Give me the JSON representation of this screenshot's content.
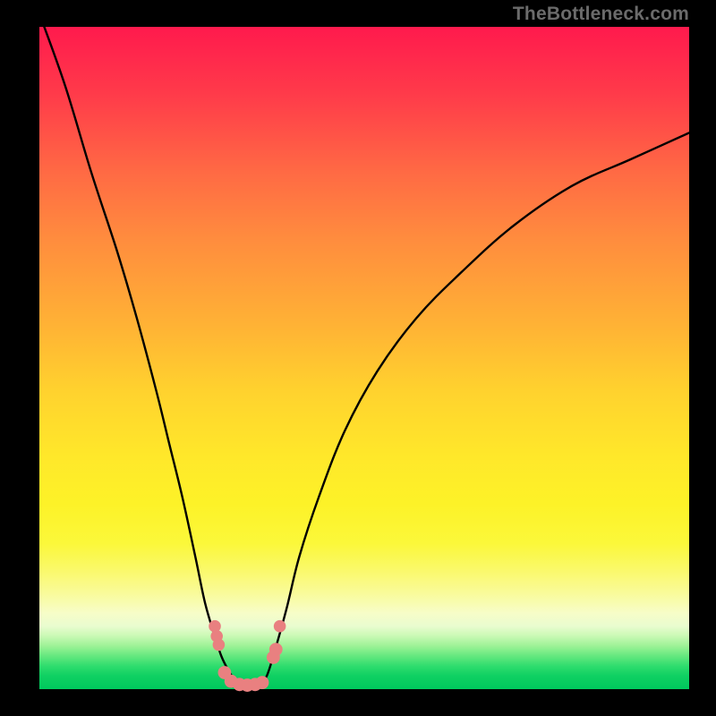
{
  "watermark": "TheBottleneck.com",
  "colors": {
    "background": "#000000",
    "curve": "#000000",
    "markers": "#e98080",
    "gradient_top": "#ff1a4d",
    "gradient_bottom": "#00c95d"
  },
  "chart_data": {
    "type": "line",
    "title": "",
    "xlabel": "",
    "ylabel": "",
    "xlim": [
      0,
      100
    ],
    "ylim": [
      0,
      100
    ],
    "grid": false,
    "series": [
      {
        "name": "left-curve",
        "x": [
          0,
          4,
          8,
          12,
          15,
          18,
          20,
          22,
          24,
          25.5,
          27,
          28,
          29,
          30,
          31
        ],
        "values": [
          102,
          91,
          78,
          66,
          56,
          45,
          37,
          29,
          20,
          13,
          8,
          5,
          3,
          1.5,
          0.5
        ]
      },
      {
        "name": "right-curve",
        "x": [
          34,
          35,
          36,
          38,
          40,
          43,
          47,
          52,
          58,
          65,
          73,
          82,
          91,
          100
        ],
        "values": [
          0.5,
          2,
          5,
          12,
          20,
          29,
          39,
          48,
          56,
          63,
          70,
          76,
          80,
          84
        ]
      }
    ],
    "markers": [
      {
        "x": 27.0,
        "y": 9.5,
        "r": 1.1
      },
      {
        "x": 27.3,
        "y": 8.0,
        "r": 1.1
      },
      {
        "x": 27.6,
        "y": 6.7,
        "r": 1.1
      },
      {
        "x": 28.5,
        "y": 2.5,
        "r": 1.2
      },
      {
        "x": 29.5,
        "y": 1.2,
        "r": 1.2
      },
      {
        "x": 30.8,
        "y": 0.7,
        "r": 1.2
      },
      {
        "x": 32.0,
        "y": 0.6,
        "r": 1.2
      },
      {
        "x": 33.2,
        "y": 0.7,
        "r": 1.2
      },
      {
        "x": 34.3,
        "y": 1.0,
        "r": 1.2
      },
      {
        "x": 36.0,
        "y": 4.8,
        "r": 1.2
      },
      {
        "x": 36.4,
        "y": 6.0,
        "r": 1.2
      },
      {
        "x": 37.0,
        "y": 9.5,
        "r": 1.1
      }
    ]
  }
}
